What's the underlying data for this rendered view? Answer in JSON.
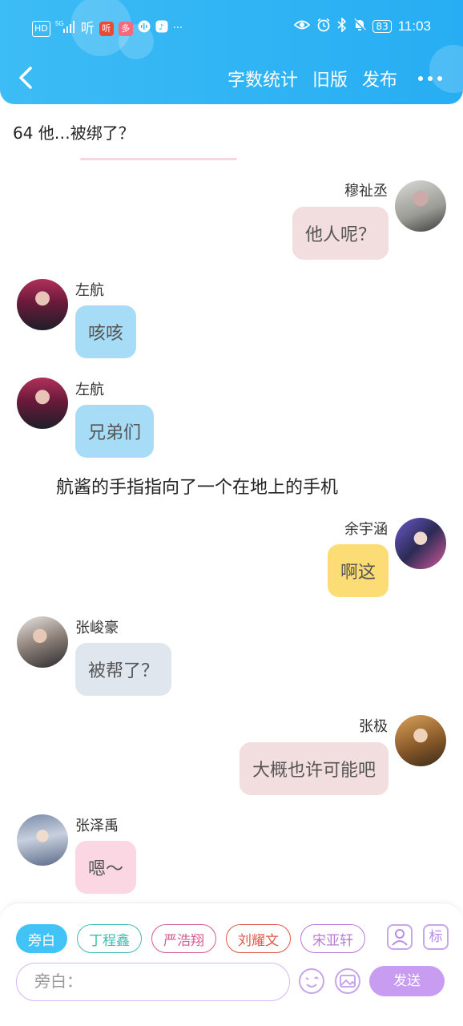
{
  "status_bar": {
    "left_icons": [
      "hd-icon",
      "5g-signal-icon",
      "ting-app-icon",
      "ting-app-red-icon",
      "orange-app-icon",
      "podcast-app-icon",
      "music-app-icon"
    ],
    "more": "···",
    "battery": "83",
    "time": "11:03"
  },
  "nav": {
    "word_count": "字数统计",
    "old_version": "旧版",
    "publish": "发布"
  },
  "chapter_title": "64 他…被绑了？",
  "messages": [
    {
      "name": "穆祉丞",
      "text": "他人呢？",
      "side": "right",
      "bubble_color": "#f2dede"
    },
    {
      "name": "左航",
      "text": "咳咳",
      "side": "left",
      "bubble_color": "#a7dcf7"
    },
    {
      "name": "左航",
      "text": "兄弟们",
      "side": "left",
      "bubble_color": "#a7dcf7"
    },
    {
      "name": "余宇涵",
      "text": "啊这",
      "side": "right",
      "bubble_color": "#fcdc74"
    },
    {
      "name": "张峻豪",
      "text": "被帮了？",
      "side": "left",
      "bubble_color": "#e0e6ee"
    },
    {
      "name": "张极",
      "text": "大概也许可能吧",
      "side": "right",
      "bubble_color": "#f2dede"
    },
    {
      "name": "张泽禹",
      "text": "嗯～",
      "side": "left",
      "bubble_color": "#fbd6e3"
    }
  ],
  "narration": "航酱的手指指向了一个在地上的手机",
  "composer": {
    "chips": [
      {
        "label": "旁白",
        "color": "#41c3f5"
      },
      {
        "label": "丁程鑫",
        "color": "#3fbcb0"
      },
      {
        "label": "严浩翔",
        "color": "#d65b94"
      },
      {
        "label": "刘耀文",
        "color": "#e0574a"
      },
      {
        "label": "宋亚轩",
        "color": "#b77ad8"
      }
    ],
    "role_icon": "person-card-icon",
    "tag_label": "标",
    "input_placeholder": "旁白：",
    "emoji_icon": "emoji-icon",
    "image_icon": "image-icon",
    "send": "发送"
  }
}
